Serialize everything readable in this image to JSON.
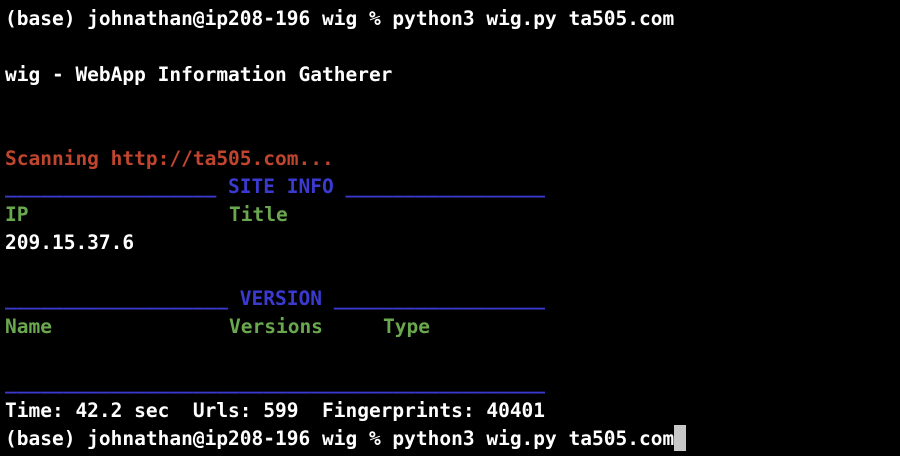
{
  "terminal": {
    "prompt_line_1": "(base) johnathan@ip208-196 wig % python3 wig.py ta505.com",
    "banner": "wig - WebApp Information Gatherer",
    "scanning": "Scanning http://ta505.com...",
    "site_info_header": "__________________ SITE INFO _________________",
    "site_info_col_ip": "IP",
    "site_info_col_title": "Title",
    "site_info_ip_value": "209.15.37.6",
    "version_header": "___________________ VERSION __________________",
    "version_col_name": "Name",
    "version_col_versions": "Versions",
    "version_col_type": "Type",
    "footer_rule": "______________________________________________",
    "stats": "Time: 42.2 sec  Urls: 599  Fingerprints: 40401",
    "prompt_line_2": "(base) johnathan@ip208-196 wig % python3 wig.py ta505.com"
  },
  "colors": {
    "background": "#000000",
    "text": "#ffffff",
    "scanning": "#c0452f",
    "header": "#3b3ad0",
    "columns": "#6aa84f"
  }
}
